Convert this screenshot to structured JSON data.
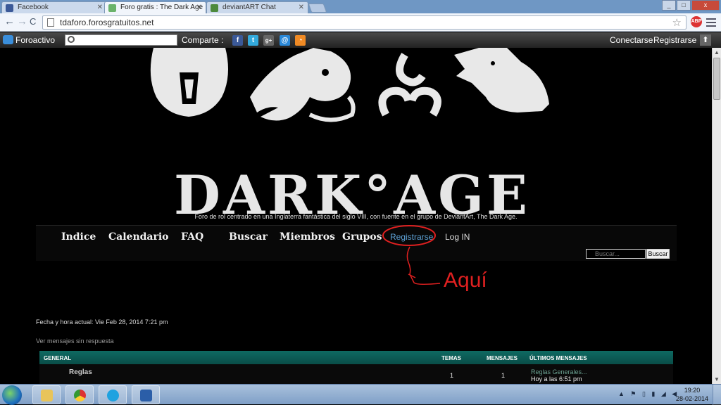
{
  "browser": {
    "tabs": [
      {
        "label": "Facebook",
        "favicon_color": "#3b5998"
      },
      {
        "label": "Foro gratis : The Dark Age",
        "favicon_color": "#6bb36b"
      },
      {
        "label": "deviantART Chat",
        "favicon_color": "#4d8a3d"
      }
    ],
    "window_buttons": {
      "minimize": "_",
      "maximize": "□",
      "close": "x"
    },
    "url": "tdaforo.forosgratuitos.net",
    "back_icon": "←",
    "forward_icon": "→",
    "reload_icon": "C",
    "star_icon": "☆",
    "abp_label": "ABP"
  },
  "foroactivo_bar": {
    "logo_text": "Foroactivo",
    "share_label": "Comparte :",
    "social_icons": [
      {
        "name": "facebook-icon",
        "glyph": "f",
        "color": "#3b5998"
      },
      {
        "name": "twitter-icon",
        "glyph": "t",
        "color": "#33aadd"
      },
      {
        "name": "google-plus-icon",
        "glyph": "g+",
        "color": "#666666"
      },
      {
        "name": "email-icon",
        "glyph": "@",
        "color": "#2a88d8"
      },
      {
        "name": "rss-icon",
        "glyph": "◔",
        "color": "#f08a24"
      }
    ],
    "login": "Conectarse",
    "register": "Registrarse",
    "up_icon": "⬆"
  },
  "banner": {
    "title": "DARK°AGE",
    "tagline": "Foro de rol centrado en una Inglaterra fantástica del siglo VIII, con fuente en el grupo de DeviantArt, The Dark Age."
  },
  "forum_nav": {
    "items": [
      "Indice",
      "Calendario",
      "FAQ",
      "Buscar",
      "Miembros",
      "Grupos",
      "Registrarse",
      "Log IN"
    ],
    "search_placeholder": "Buscar...",
    "search_button": "Buscar"
  },
  "annotation": {
    "text": "Aquí",
    "color": "#e02020"
  },
  "info": {
    "date_line": "Fecha y hora actual: Vie Feb 28, 2014 7:21 pm",
    "unanswered_link": "Ver mensajes sin respuesta"
  },
  "category_table": {
    "headers": {
      "category": "GENERAL",
      "topics": "TEMAS",
      "posts": "MENSAJES",
      "last": "ÚLTIMOS MENSAJES"
    },
    "rows": [
      {
        "name": "Reglas",
        "topics": "1",
        "posts": "1",
        "last_title": "Reglas Generales...",
        "last_time": "Hoy a las 6:51 pm"
      }
    ]
  },
  "taskbar": {
    "clock_time": "19:20",
    "clock_date": "28-02-2014",
    "tray_icons": "▲ ⚑ ▯ ▮ ◢ ◀"
  }
}
